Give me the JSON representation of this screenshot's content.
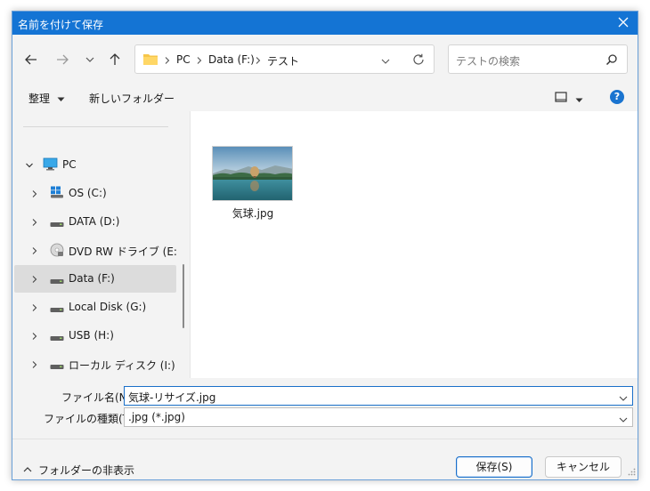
{
  "window": {
    "title": "名前を付けて保存"
  },
  "address": {
    "crumbs": [
      "PC",
      "Data (F:)",
      "テスト"
    ]
  },
  "search": {
    "placeholder": "テストの検索"
  },
  "toolbar": {
    "organize_label": "整理",
    "new_folder_label": "新しいフォルダー"
  },
  "tree": {
    "root": {
      "label": "PC"
    },
    "items": [
      {
        "label": "OS (C:)",
        "icon": "windows-drive-icon"
      },
      {
        "label": "DATA (D:)",
        "icon": "drive-icon"
      },
      {
        "label": "DVD RW ドライブ (E:) Aud",
        "icon": "dvd-icon"
      },
      {
        "label": "Data (F:)",
        "icon": "drive-icon",
        "selected": true
      },
      {
        "label": "Local Disk (G:)",
        "icon": "drive-icon"
      },
      {
        "label": "USB (H:)",
        "icon": "drive-icon"
      },
      {
        "label": "ローカル ディスク (I:)",
        "icon": "drive-icon"
      }
    ]
  },
  "files": [
    {
      "name": "気球.jpg",
      "icon": "image-thumbnail"
    }
  ],
  "form": {
    "filename_label": "ファイル名(N):",
    "filename_value": "気球-リサイズ.jpg",
    "filetype_label": "ファイルの種類(T):",
    "filetype_value": ".jpg (*.jpg)"
  },
  "footer": {
    "hide_folders_label": "フォルダーの非表示",
    "save_label": "保存(S)",
    "cancel_label": "キャンセル"
  },
  "colors": {
    "titlebar": "#1474d4",
    "accent": "#1a6fc9",
    "selection": "#dcdcdc"
  }
}
